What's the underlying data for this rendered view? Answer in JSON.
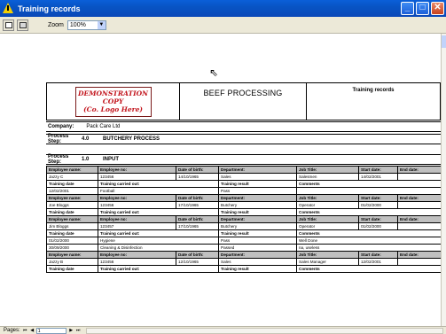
{
  "window": {
    "title": "Training records"
  },
  "toolbar": {
    "zoom_label": "Zoom",
    "zoom_value": "100%"
  },
  "report": {
    "logo_lines": [
      "DEMONSTRATION",
      "COPY",
      "(Co. Logo Here)"
    ],
    "company_title": "BEEF PROCESSING",
    "report_title": "Training records",
    "company_label": "Company:",
    "company_value": "Pack Care Ltd",
    "process_label": "Process Step:",
    "process1": {
      "num": "4.0",
      "name": "BUTCHERY PROCESS"
    },
    "process2": {
      "num": "1.0",
      "name": "INPUT"
    }
  },
  "table": {
    "emp_headers": [
      "Employee name:",
      "Employee no:",
      "Date of birth:",
      "Department:",
      "Job Title:",
      "Start date:",
      "End date:"
    ],
    "training_headers": [
      "Training date",
      "Training carried out:",
      "Training result",
      "Comments"
    ],
    "employees": [
      {
        "name": "Jazzy C",
        "no": "123456",
        "dob": "14/10/1965",
        "dept": "Sales",
        "title": "Salesmen",
        "start": "14/02/2001",
        "end": "",
        "trainings": [
          {
            "date": "12/02/2001",
            "what": "Football",
            "result": "Pass",
            "comment": ""
          }
        ]
      },
      {
        "name": "Joe Bloggs",
        "no": "123456",
        "dob": "17/10/1965",
        "dept": "Butchery",
        "title": "Operator",
        "start": "01/02/2000",
        "end": "",
        "trainings": []
      },
      {
        "name": "Jim Bloggs",
        "no": "123457",
        "dob": "17/10/1965",
        "dept": "Butchery",
        "title": "Operator",
        "start": "01/02/2000",
        "end": "",
        "trainings": [
          {
            "date": "01/02/2000",
            "what": "Hygiene",
            "result": "Pass",
            "comment": "Well Done"
          },
          {
            "date": "30/09/2000",
            "what": "Cleaning & Disinfection",
            "result": "Passed",
            "comment": "na, useless"
          }
        ]
      },
      {
        "name": "Jazzy B",
        "no": "123456",
        "dob": "12/10/1965",
        "dept": "Sales",
        "title": "Sales Manager",
        "start": "12/02/2001",
        "end": "",
        "trainings": []
      }
    ]
  },
  "status": {
    "pages_label": "Pages:",
    "page_value": "1"
  }
}
